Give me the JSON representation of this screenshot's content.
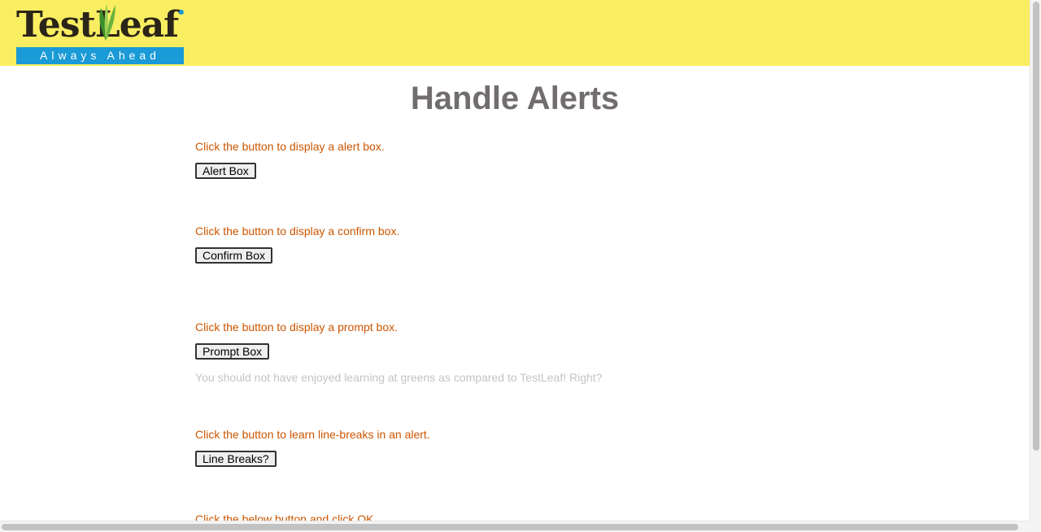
{
  "header": {
    "logo": {
      "wordmark": "TestLeaf",
      "tagline": "Always Ahead"
    }
  },
  "page": {
    "title": "Handle Alerts"
  },
  "sections": [
    {
      "instruction": "Click the button to display a alert box.",
      "button_label": "Alert Box"
    },
    {
      "instruction": "Click the button to display a confirm box.",
      "button_label": "Confirm Box"
    },
    {
      "instruction": "Click the button to display a prompt box.",
      "button_label": "Prompt Box",
      "result_text": "You should not have enjoyed learning at greens as compared to TestLeaf! Right?"
    },
    {
      "instruction": "Click the button to learn line-breaks in an alert.",
      "button_label": "Line Breaks?"
    },
    {
      "instruction": "Click the below button and click OK."
    }
  ],
  "colors": {
    "header_bg": "#f9ee61",
    "logo_bar": "#1a9ad6",
    "title": "#726d6d",
    "instruction_text": "#cc5500",
    "hint_text": "#c4c4c4"
  }
}
